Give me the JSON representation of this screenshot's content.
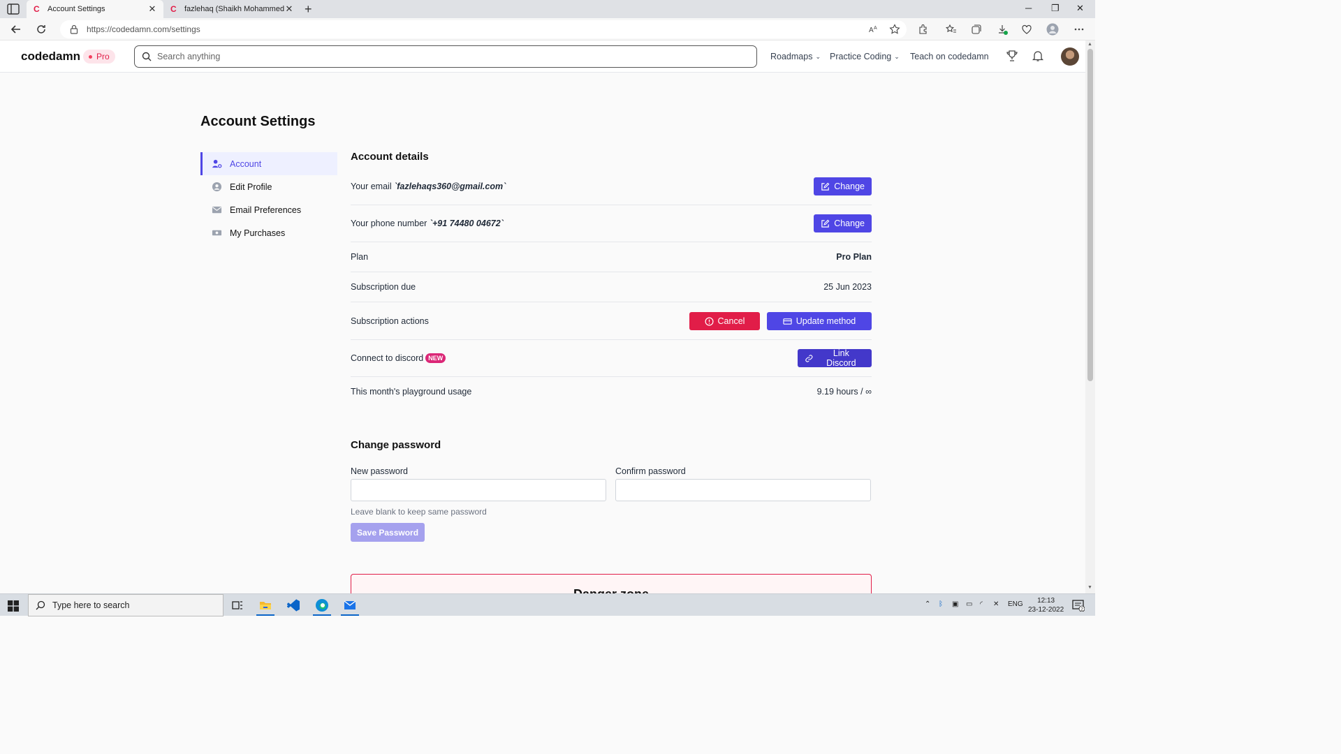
{
  "browser": {
    "tabs": [
      {
        "title": "Account Settings",
        "favicon": "C",
        "active": true
      },
      {
        "title": "fazlehaq (Shaikh Mohammed Fazlehaq)",
        "favicon": "C",
        "active": false
      }
    ],
    "url": "https://codedamn.com/settings"
  },
  "header": {
    "brand": "codedamn",
    "badge": "Pro",
    "search_placeholder": "Search anything",
    "nav": {
      "roadmaps": "Roadmaps",
      "practice": "Practice Coding",
      "teach": "Teach on codedamn"
    }
  },
  "page": {
    "title": "Account Settings",
    "sidebar": [
      {
        "label": "Account",
        "icon": "user-gear-icon",
        "active": true
      },
      {
        "label": "Edit Profile",
        "icon": "user-circle-icon",
        "active": false
      },
      {
        "label": "Email Preferences",
        "icon": "envelope-icon",
        "active": false
      },
      {
        "label": "My Purchases",
        "icon": "money-icon",
        "active": false
      }
    ],
    "account_details": {
      "title": "Account details",
      "email_label": "Your email",
      "email_value": "`fazlehaqs360@gmail.com`",
      "phone_label": "Your phone number",
      "phone_value": "`+91 74480 04672`",
      "change_label": "Change",
      "plan_label": "Plan",
      "plan_value": "Pro Plan",
      "sub_due_label": "Subscription due",
      "sub_due_value": "25 Jun 2023",
      "sub_actions_label": "Subscription actions",
      "cancel_label": "Cancel",
      "update_method_label": "Update method",
      "discord_label": "Connect to discord",
      "new_badge": "NEW",
      "link_discord_label": "Link Discord",
      "usage_label": "This month's playground usage",
      "usage_value": "9.19 hours / ∞"
    },
    "change_password": {
      "title": "Change password",
      "new_label": "New password",
      "confirm_label": "Confirm password",
      "hint": "Leave blank to keep same password",
      "save_label": "Save Password"
    },
    "danger_title": "Danger zone"
  },
  "taskbar": {
    "search_placeholder": "Type here to search",
    "lang": "ENG",
    "time": "12:13",
    "date": "23-12-2022",
    "notifications": "2"
  },
  "colors": {
    "accent": "#4f46e5",
    "danger": "#e11d48",
    "new_badge": "#db2777"
  }
}
